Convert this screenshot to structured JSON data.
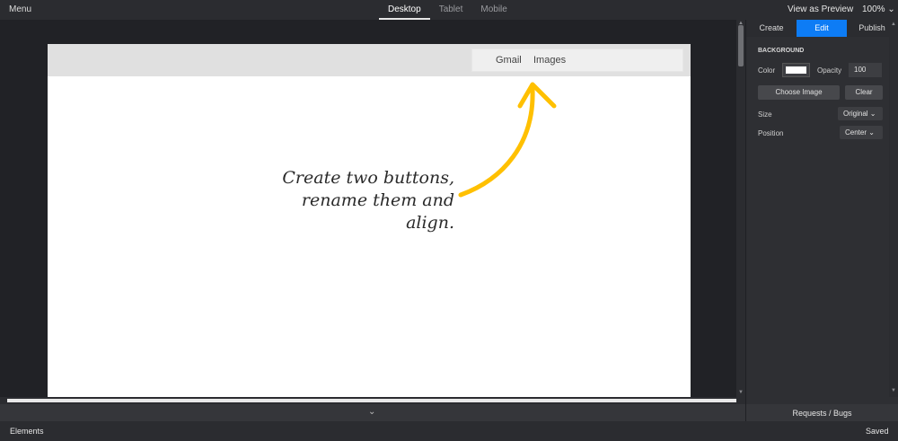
{
  "topbar": {
    "menu_label": "Menu",
    "views": [
      "Desktop",
      "Tablet",
      "Mobile"
    ],
    "active_view": "Desktop",
    "preview_label": "View as Preview",
    "zoom_label": "100% ⌄"
  },
  "canvas": {
    "buttons": [
      "Gmail",
      "Images"
    ],
    "hint_line1": "Create two buttons,",
    "hint_line2": "rename them and align.",
    "arrow_color": "#ffc000"
  },
  "panel": {
    "tabs": [
      "Create",
      "Edit",
      "Publish"
    ],
    "active_tab": "Edit",
    "section_title": "BACKGROUND",
    "color_label": "Color",
    "color_value": "#ffffff",
    "opacity_label": "Opacity",
    "opacity_value": "100",
    "choose_image_label": "Choose Image",
    "clear_label": "Clear",
    "size_label": "Size",
    "size_value": "Original ⌄",
    "position_label": "Position",
    "position_value": "Center ⌄"
  },
  "footer": {
    "collapse_icon": "chevron-down-icon",
    "requests_label": "Requests / Bugs",
    "elements_label": "Elements",
    "saved_label": "Saved"
  },
  "colors": {
    "accent": "#0d7cf5",
    "dark_bg": "#1f2024"
  }
}
